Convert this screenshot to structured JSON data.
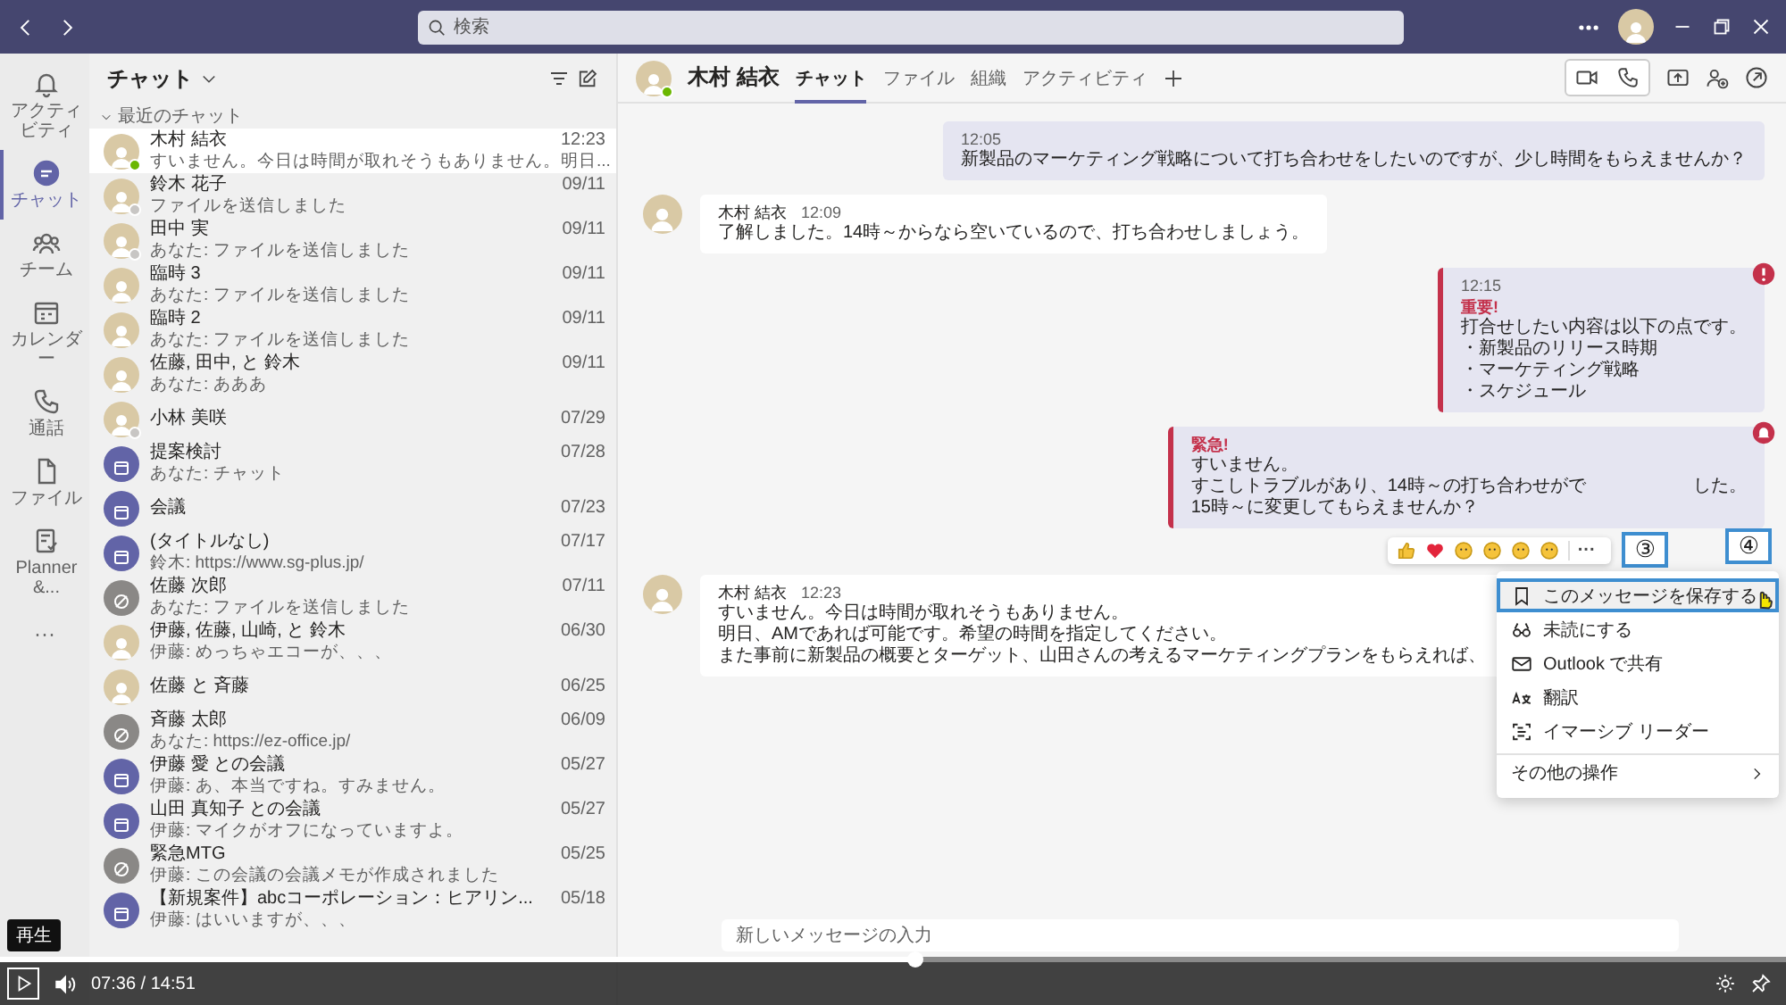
{
  "title_bar": {
    "search_placeholder": "検索"
  },
  "rail": {
    "items": [
      {
        "label": "アクティビティ",
        "kind": "bell",
        "selected": false
      },
      {
        "label": "チャット",
        "kind": "chat",
        "selected": true
      },
      {
        "label": "チーム",
        "kind": "team",
        "selected": false
      },
      {
        "label": "カレンダー",
        "kind": "calendar",
        "selected": false
      },
      {
        "label": "通話",
        "kind": "phone",
        "selected": false
      },
      {
        "label": "ファイル",
        "kind": "file",
        "selected": false
      },
      {
        "label": "Planner &...",
        "kind": "planner",
        "selected": false
      }
    ],
    "more": "···"
  },
  "chat_list": {
    "title": "チャット",
    "section": "最近のチャット",
    "chats": [
      {
        "name": "木村 結衣",
        "preview": "すいません。今日は時間が取れそうもありません。明日...",
        "time": "12:23",
        "kind": "person",
        "color": "#6bb700",
        "selected": true
      },
      {
        "name": "鈴木 花子",
        "preview": "ファイルを送信しました",
        "time": "09/11",
        "kind": "person",
        "color": "#c8c6c4",
        "selected": false
      },
      {
        "name": "田中 実",
        "preview": "あなた: ファイルを送信しました",
        "time": "09/11",
        "kind": "person",
        "color": "#c8c6c4",
        "selected": false
      },
      {
        "name": "臨時 3",
        "preview": "あなた: ファイルを送信しました",
        "time": "09/11",
        "kind": "person",
        "selected": false
      },
      {
        "name": "臨時 2",
        "preview": "あなた: ファイルを送信しました",
        "time": "09/11",
        "kind": "person",
        "selected": false
      },
      {
        "name": "佐藤, 田中, と 鈴木",
        "preview": "あなた: あああ",
        "time": "09/11",
        "kind": "person",
        "selected": false
      },
      {
        "name": "小林 美咲",
        "time": "07/29",
        "kind": "person",
        "color": "#c8c6c4",
        "selected": false
      },
      {
        "name": "提案検討",
        "preview": "あなた: チャット",
        "time": "07/28",
        "kind": "group",
        "selected": false
      },
      {
        "name": "会議",
        "time": "07/23",
        "kind": "group",
        "selected": false
      },
      {
        "name": "(タイトルなし)",
        "preview": "鈴木: https://www.sg-plus.jp/",
        "time": "07/17",
        "kind": "group",
        "selected": false
      },
      {
        "name": "佐藤 次郎",
        "preview": "あなた: ファイルを送信しました",
        "time": "07/11",
        "kind": "blocked",
        "selected": false
      },
      {
        "name": "伊藤, 佐藤, 山崎, と 鈴木",
        "preview": "伊藤: めっちゃエコーが、、、",
        "time": "06/30",
        "kind": "person",
        "selected": false
      },
      {
        "name": "佐藤 と 斉藤",
        "time": "06/25",
        "kind": "person",
        "selected": false
      },
      {
        "name": "斉藤 太郎",
        "preview": "あなた: https://ez-office.jp/",
        "time": "06/09",
        "kind": "blocked",
        "selected": false
      },
      {
        "name": "伊藤 愛 との会議",
        "preview": "伊藤: あ、本当ですね。すみません。",
        "time": "05/27",
        "kind": "group",
        "selected": false
      },
      {
        "name": "山田 真知子 との会議",
        "preview": "伊藤: マイクがオフになっていますよ。",
        "time": "05/27",
        "kind": "group",
        "selected": false
      },
      {
        "name": "緊急MTG",
        "preview": "伊藤: この会議の会議メモが作成されました",
        "time": "05/25",
        "kind": "blocked",
        "selected": false
      },
      {
        "name": "【新規案件】abcコーポレーション：ヒアリン...",
        "preview": "伊藤: はいいますが、、、",
        "time": "05/18",
        "kind": "group",
        "selected": false
      }
    ]
  },
  "conversation": {
    "contact": "木村 結衣",
    "contact_presence": {
      "color": "#6bb700"
    },
    "tabs": [
      {
        "label": "チャット",
        "selected": true
      },
      {
        "label": "ファイル",
        "selected": false
      },
      {
        "label": "組織",
        "selected": false
      },
      {
        "label": "アクティビティ",
        "selected": false
      }
    ],
    "messages": [
      {
        "kind": "sent",
        "time": "12:05",
        "lines": [
          "新製品のマーケティング戦略について打ち合わせをしたいのですが、少し時間をもらえませんか？"
        ]
      },
      {
        "kind": "received",
        "author": "木村 結衣",
        "time": "12:09",
        "lines": [
          "了解しました。14時～からなら空いているので、打ち合わせしましょう。"
        ]
      },
      {
        "kind": "important",
        "time": "12:15",
        "priority_label": "重要!",
        "lines": [
          "打合せしたい内容は以下の点です。",
          "・新製品のリリース時期",
          "・マーケティング戦略",
          "・スケジュール"
        ]
      },
      {
        "kind": "urgent",
        "priority_label": "緊急!",
        "lines": [
          "すいません。",
          [
            "すこしトラブルがあり、14時～の打ち合わせがで",
            "した。"
          ],
          "15時～に変更してもらえませんか？"
        ]
      },
      {
        "kind": "received",
        "author": "木村 結衣",
        "time": "12:23",
        "lines": [
          "すいません。今日は時間が取れそうもありません。",
          "明日、AMであれば可能です。希望の時間を指定してください。",
          "また事前に新製品の概要とターゲット、山田さんの考えるマーケティングプランをもらえれば、"
        ]
      }
    ],
    "reaction_bar": {
      "more": "···",
      "callout": "③"
    },
    "context_menu": {
      "callout": "④",
      "items": [
        {
          "label": "このメッセージを保存する",
          "kind": "save",
          "selected": true
        },
        {
          "label": "未読にする",
          "kind": "unread",
          "selected": false
        },
        {
          "label": "Outlook で共有",
          "kind": "mail",
          "selected": false
        },
        {
          "label": "翻訳",
          "kind": "translate",
          "selected": false
        },
        {
          "label": "イマーシブ リーダー",
          "kind": "reader",
          "selected": false
        },
        {
          "label": "その他の操作",
          "kind": "submenu",
          "selected": false
        }
      ]
    },
    "composer": {
      "placeholder": "新しいメッセージの入力"
    }
  },
  "player": {
    "tooltip": "再生",
    "time": "07:36 / 14:51",
    "level": 0.512
  }
}
